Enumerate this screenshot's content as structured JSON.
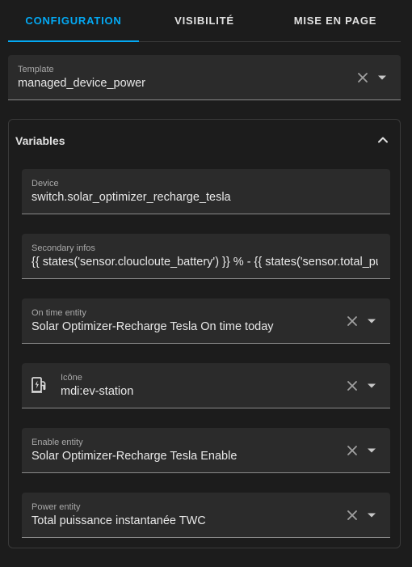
{
  "tabs": [
    {
      "label": "CONFIGURATION",
      "active": true
    },
    {
      "label": "VISIBILITÉ",
      "active": false
    },
    {
      "label": "MISE EN PAGE",
      "active": false
    }
  ],
  "template": {
    "label": "Template",
    "value": "managed_device_power"
  },
  "variables": {
    "title": "Variables",
    "fields": [
      {
        "label": "Device",
        "value": "switch.solar_optimizer_recharge_tesla"
      },
      {
        "label": "Secondary infos",
        "value": "{{ states('sensor.cloucloute_battery') }} % -  {{ states('sensor.total_puissance_instantanee_twc') }}"
      },
      {
        "label": "On time entity",
        "value": "Solar Optimizer-Recharge Tesla On time today"
      },
      {
        "label": "Icône",
        "value": "mdi:ev-station",
        "icon": "ev-station-icon"
      },
      {
        "label": "Enable entity",
        "value": "Solar Optimizer-Recharge Tesla Enable"
      },
      {
        "label": "Power entity",
        "value": "Total puissance instantanée TWC"
      }
    ]
  },
  "colors": {
    "accent": "#03a9f4",
    "background": "#1c1c1c",
    "field_background": "#2b2b2b"
  }
}
